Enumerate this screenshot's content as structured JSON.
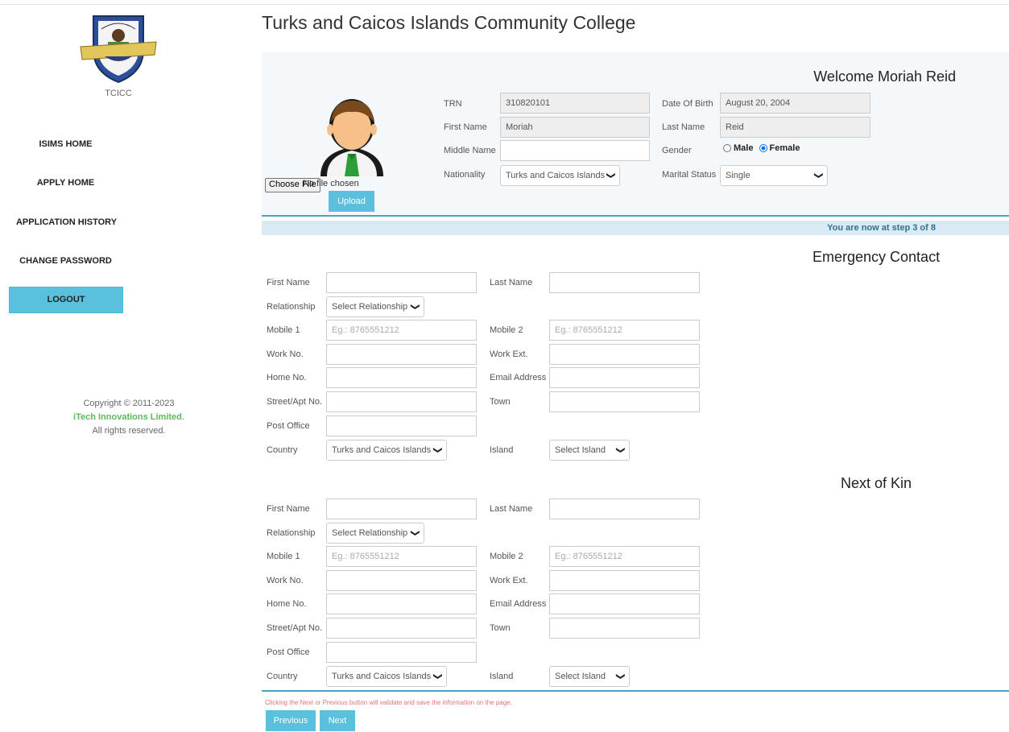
{
  "app": {
    "title": "Turks and Caicos Islands Community College"
  },
  "sidebar": {
    "logo_text": "TCICC",
    "items": [
      {
        "label": "ISIMS HOME"
      },
      {
        "label": "APPLY HOME"
      },
      {
        "label": "APPLICATION HISTORY"
      },
      {
        "label": "CHANGE PASSWORD"
      }
    ],
    "logout_label": "LOGOUT",
    "copyright": {
      "line1": "Copyright © 2011-2023",
      "company": "iTech Innovations Limited",
      "dot": ".",
      "line3": "All rights reserved."
    }
  },
  "profile": {
    "welcome": "Welcome Moriah Reid",
    "choose_file_label": "Choose File",
    "no_file_text": "No file chosen",
    "upload_label": "Upload",
    "fields": {
      "trn": {
        "label": "TRN",
        "value": "310820101"
      },
      "dob": {
        "label": "Date Of Birth",
        "value": "August 20, 2004"
      },
      "first_name": {
        "label": "First Name",
        "value": "Moriah"
      },
      "last_name": {
        "label": "Last Name",
        "value": "Reid"
      },
      "middle_name": {
        "label": "Middle Name",
        "value": ""
      },
      "gender": {
        "label": "Gender",
        "options": [
          "Male",
          "Female"
        ],
        "selected": "Female"
      },
      "nationality": {
        "label": "Nationality",
        "value": "Turks and Caicos Islands"
      },
      "marital_status": {
        "label": "Marital Status",
        "value": "Single"
      }
    }
  },
  "step": {
    "text": "You are now at step 3 of 8"
  },
  "emergency": {
    "title": "Emergency Contact",
    "labels": {
      "first_name": "First Name",
      "last_name": "Last Name",
      "relationship": "Relationship",
      "mobile1": "Mobile 1",
      "mobile2": "Mobile 2",
      "work_no": "Work No.",
      "work_ext": "Work Ext.",
      "home_no": "Home No.",
      "email": "Email Address",
      "street": "Street/Apt No.",
      "town": "Town",
      "post_office": "Post Office",
      "country": "Country",
      "island": "Island"
    },
    "relationship_value": "Select Relationship",
    "mobile_placeholder": "Eg.: 8765551212",
    "country_value": "Turks and Caicos Islands",
    "island_value": "Select Island"
  },
  "kin": {
    "title": "Next of Kin",
    "labels": {
      "first_name": "First Name",
      "last_name": "Last Name",
      "relationship": "Relationship",
      "mobile1": "Mobile 1",
      "mobile2": "Mobile 2",
      "work_no": "Work No.",
      "work_ext": "Work Ext.",
      "home_no": "Home No.",
      "email": "Email Address",
      "street": "Street/Apt No.",
      "town": "Town",
      "post_office": "Post Office",
      "country": "Country",
      "island": "Island"
    },
    "relationship_value": "Select Relationship",
    "mobile_placeholder": "Eg.: 8765551212",
    "country_value": "Turks and Caicos Islands",
    "island_value": "Select Island"
  },
  "footer": {
    "note": "Clicking the Next or Previous button will validate and save the information on the page.",
    "previous_label": "Previous",
    "next_label": "Next"
  },
  "colors": {
    "accent": "#5bc0de",
    "divider": "#4aa3c7",
    "panel_bg": "#f5f8fa",
    "step_bg": "#d9eaf5",
    "link_green": "#5cb85c"
  }
}
